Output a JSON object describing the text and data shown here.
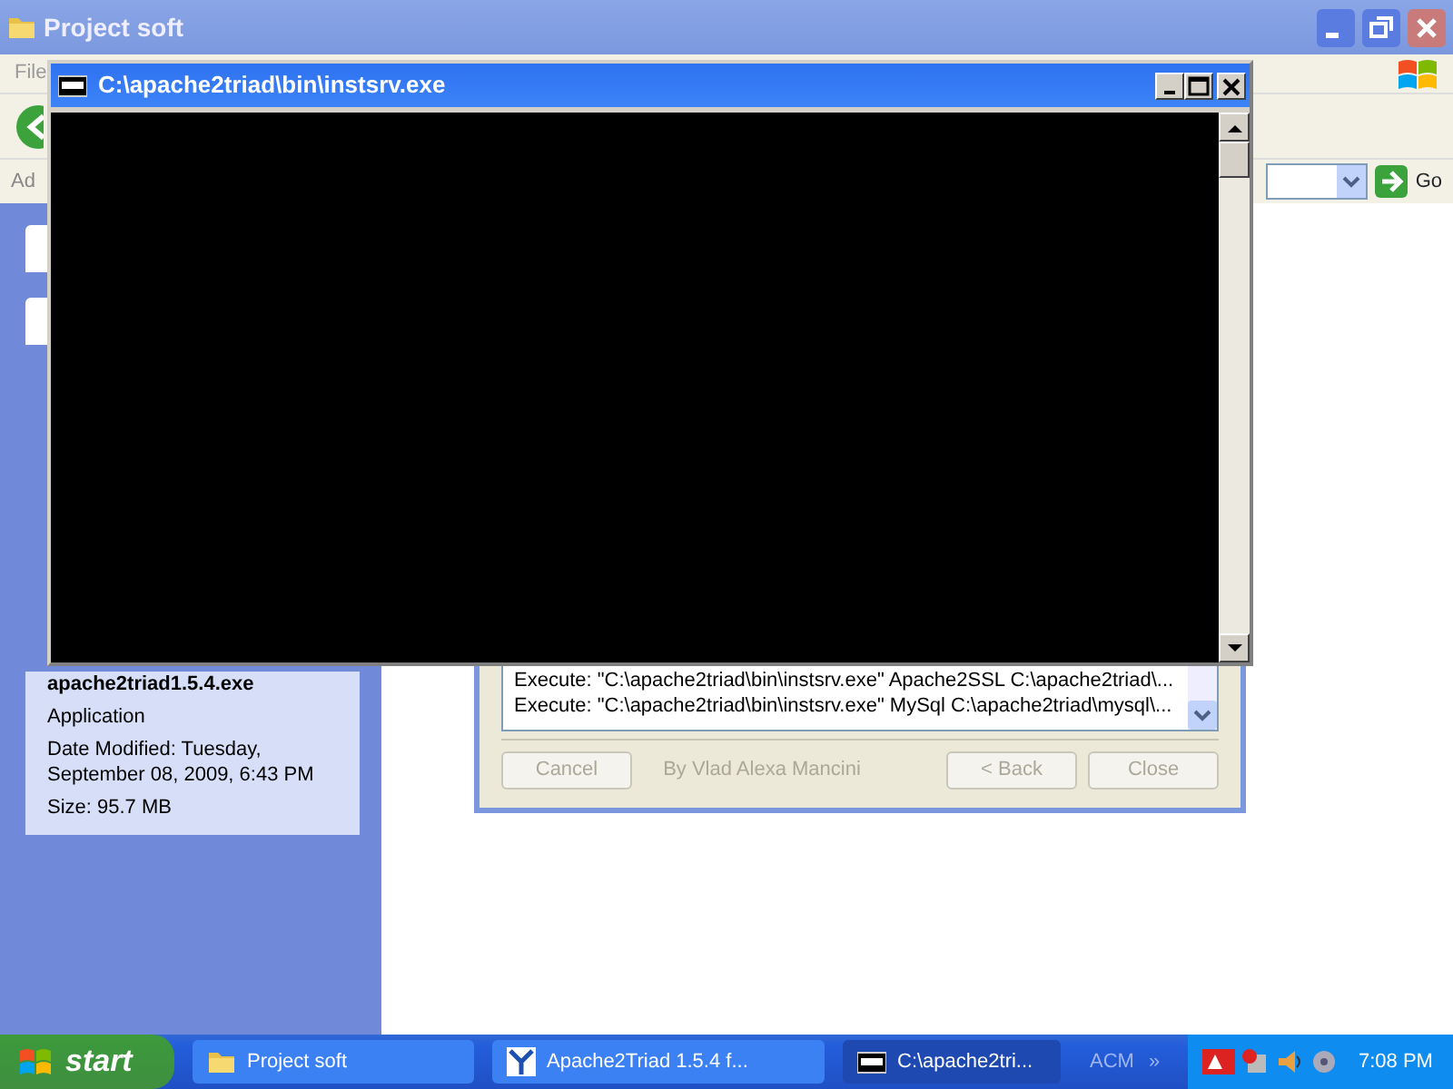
{
  "explorer": {
    "title": "Project soft",
    "menu": [
      "File"
    ],
    "address_label": "Ad",
    "go_button": "Go",
    "details": {
      "name": "apache2triad1.5.4.exe",
      "type": "Application",
      "modified": "Date Modified: Tuesday, September 08, 2009, 6:43 PM",
      "size": "Size: 95.7 MB"
    }
  },
  "installer": {
    "log": [
      "Execute: \"C:\\apache2triad\\bin\\instsrv.exe\" Apache2SSL C:\\apache2triad\\...",
      "Execute: \"C:\\apache2triad\\bin\\instsrv.exe\" MySql C:\\apache2triad\\mysql\\..."
    ],
    "buttons": [
      {
        "label": "Cancel",
        "disabled": true
      },
      {
        "label": "By Vlad Alexa Mancini",
        "kind": "credit"
      },
      {
        "label": "< Back",
        "disabled": true
      },
      {
        "label": "Close",
        "disabled": true
      }
    ]
  },
  "console": {
    "title": "C:\\apache2triad\\bin\\instsrv.exe"
  },
  "taskbar": {
    "start": "start",
    "tasks": [
      {
        "label": "Project soft",
        "kind": "folder",
        "selected": false
      },
      {
        "label": "Apache2Triad 1.5.4 f...",
        "kind": "installer",
        "selected": false
      },
      {
        "label": "C:\\apache2tri...",
        "kind": "console",
        "selected": true
      }
    ],
    "toolbar_label": "ACM",
    "chevron": "»",
    "clock": "7:08 PM"
  }
}
